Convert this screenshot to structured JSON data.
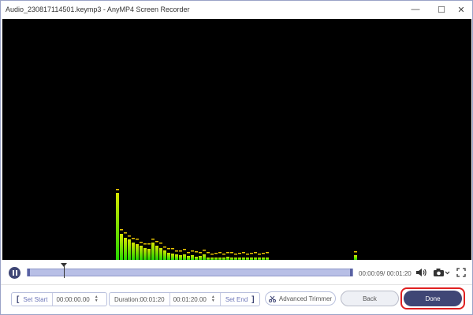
{
  "window": {
    "title": "Audio_230817114501.keymp3  -  AnyMP4 Screen Recorder",
    "minimize_label": "—",
    "maximize_label": "☐",
    "close_label": "✕"
  },
  "visualizer": {
    "bar_color_top": "#d6e600",
    "bar_color_bottom": "#24d400",
    "peak_color": "#e8c400",
    "levels": [
      0.85,
      0.33,
      0.28,
      0.26,
      0.22,
      0.2,
      0.18,
      0.15,
      0.14,
      0.22,
      0.18,
      0.15,
      0.12,
      0.09,
      0.08,
      0.07,
      0.06,
      0.07,
      0.05,
      0.06,
      0.04,
      0.05,
      0.07,
      0.03,
      0.03,
      0.03,
      0.03,
      0.03,
      0.04,
      0.02,
      0.02,
      0.02,
      0.02,
      0.02,
      0.02,
      0.02,
      0.02,
      0.02,
      0.02,
      0.06
    ]
  },
  "playback": {
    "time_readout": "00:00:09/ 00:01:20",
    "progress": 0.1125
  },
  "trim": {
    "set_start_label": "Set Start",
    "start_time": "00:00:00.00",
    "duration": "Duration:00:01:20",
    "end_time": "00:01:20.00",
    "set_end_label": "Set End",
    "advanced_trimmer_label": "Advanced Trimmer"
  },
  "actions": {
    "back_label": "Back",
    "done_label": "Done"
  }
}
